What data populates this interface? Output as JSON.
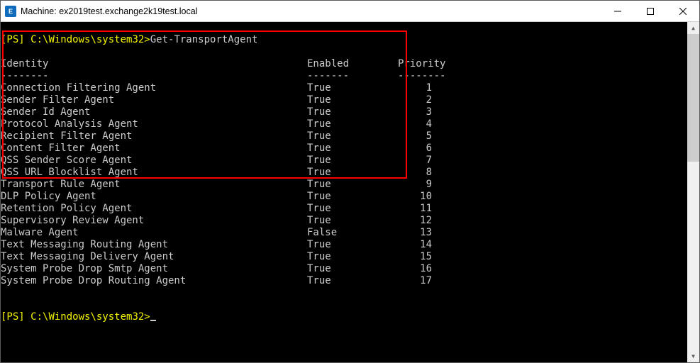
{
  "window": {
    "title": "Machine: ex2019test.exchange2k19test.local"
  },
  "prompt1": {
    "ps": "[PS] ",
    "path": "C:\\Windows\\system32>",
    "command": "Get-TransportAgent"
  },
  "headers": {
    "identity": "Identity",
    "enabled": "Enabled",
    "priority": "Priority"
  },
  "divider": {
    "identity": "--------",
    "enabled": "-------",
    "priority": "--------"
  },
  "rows": [
    {
      "identity": "Connection Filtering Agent",
      "enabled": "True",
      "priority": "1"
    },
    {
      "identity": "Sender Filter Agent",
      "enabled": "True",
      "priority": "2"
    },
    {
      "identity": "Sender Id Agent",
      "enabled": "True",
      "priority": "3"
    },
    {
      "identity": "Protocol Analysis Agent",
      "enabled": "True",
      "priority": "4"
    },
    {
      "identity": "Recipient Filter Agent",
      "enabled": "True",
      "priority": "5"
    },
    {
      "identity": "Content Filter Agent",
      "enabled": "True",
      "priority": "6"
    },
    {
      "identity": "QSS Sender Score Agent",
      "enabled": "True",
      "priority": "7"
    },
    {
      "identity": "QSS URL Blocklist Agent",
      "enabled": "True",
      "priority": "8"
    },
    {
      "identity": "Transport Rule Agent",
      "enabled": "True",
      "priority": "9"
    },
    {
      "identity": "DLP Policy Agent",
      "enabled": "True",
      "priority": "10"
    },
    {
      "identity": "Retention Policy Agent",
      "enabled": "True",
      "priority": "11"
    },
    {
      "identity": "Supervisory Review Agent",
      "enabled": "True",
      "priority": "12"
    },
    {
      "identity": "Malware Agent",
      "enabled": "False",
      "priority": "13"
    },
    {
      "identity": "Text Messaging Routing Agent",
      "enabled": "True",
      "priority": "14"
    },
    {
      "identity": "Text Messaging Delivery Agent",
      "enabled": "True",
      "priority": "15"
    },
    {
      "identity": "System Probe Drop Smtp Agent",
      "enabled": "True",
      "priority": "16"
    },
    {
      "identity": "System Probe Drop Routing Agent",
      "enabled": "True",
      "priority": "17"
    }
  ],
  "prompt2": {
    "ps": "[PS] ",
    "path": "C:\\Windows\\system32>"
  },
  "icon_text": "E"
}
